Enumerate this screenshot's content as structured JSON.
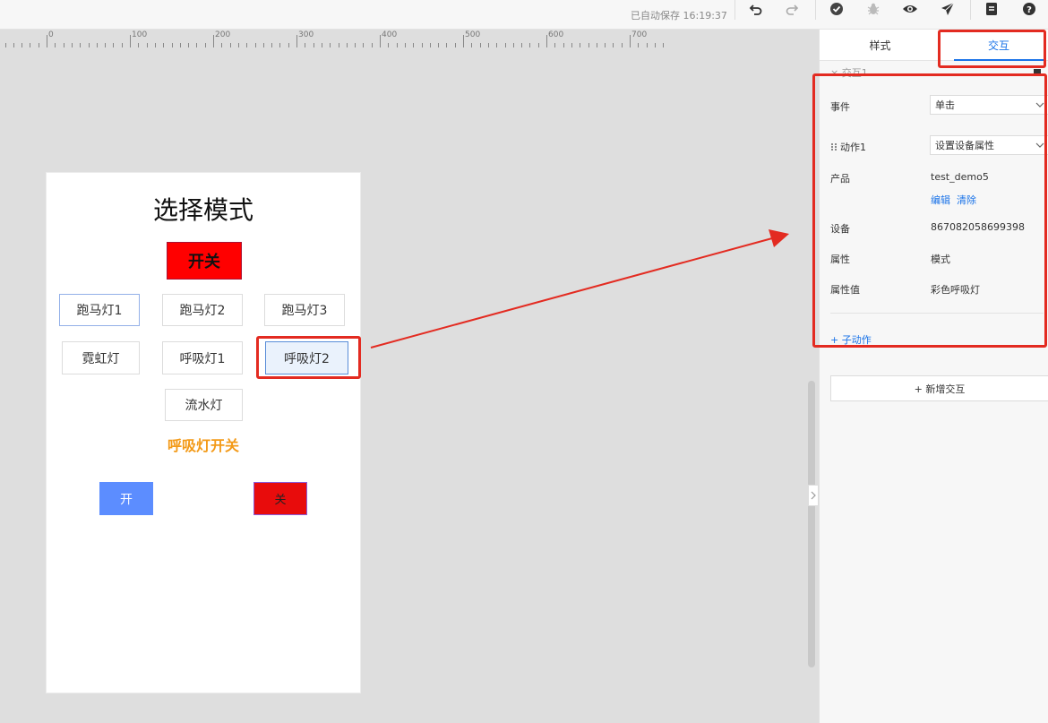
{
  "toolbar": {
    "autosave_text": "已自动保存 16:19:37",
    "icons": [
      "undo-icon",
      "redo-icon",
      "check-circle-icon",
      "bug-icon",
      "eye-icon",
      "send-icon",
      "document-icon",
      "help-icon"
    ]
  },
  "ruler": {
    "labels": [
      "0",
      "100",
      "200",
      "300",
      "400",
      "500",
      "600",
      "700"
    ]
  },
  "canvas": {
    "title": "选择模式",
    "power_button": "开关",
    "mode_buttons": [
      "跑马灯1",
      "跑马灯2",
      "跑马灯3",
      "霓虹灯",
      "呼吸灯1",
      "呼吸灯2",
      "流水灯"
    ],
    "breath_label": "呼吸灯开关",
    "on_button": "开",
    "off_button": "关"
  },
  "panel": {
    "tabs": [
      "样式",
      "交互"
    ],
    "active_tab": "交互",
    "section_peek": "× 交互1",
    "event_label": "事件",
    "event_value": "单击",
    "action_label": "动作1",
    "action_value": "设置设备属性",
    "product_label": "产品",
    "product_value": "test_demo5",
    "edit_link": "编辑",
    "clear_link": "清除",
    "device_label": "设备",
    "device_value": "867082058699398",
    "property_label": "属性",
    "property_value": "模式",
    "property_value_label": "属性值",
    "property_value_value": "彩色呼吸灯",
    "sub_action": "+ 子动作",
    "add_interaction": "+ 新增交互"
  },
  "colors": {
    "accent": "#1a73e8",
    "power_red": "#ff0000",
    "on_blue": "#5c8dff",
    "off_red": "#e80c0c",
    "breath_orange": "#f39a18",
    "annotation_red": "#e32b21"
  }
}
